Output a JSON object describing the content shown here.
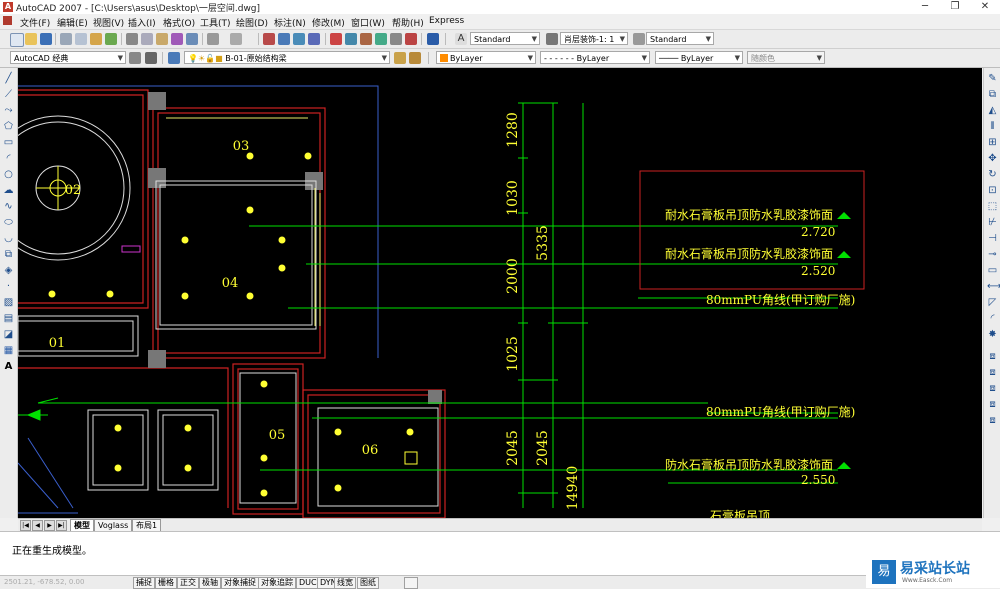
{
  "window": {
    "title": "AutoCAD 2007 - [C:\\Users\\asus\\Desktop\\一层空间.dwg]",
    "minimize": "─",
    "maximize": "❐",
    "close": "✕"
  },
  "menu": [
    "文件(F)",
    "编辑(E)",
    "视图(V)",
    "插入(I)",
    "格式(O)",
    "工具(T)",
    "绘图(D)",
    "标注(N)",
    "修改(M)",
    "窗口(W)",
    "帮助(H)",
    "Express"
  ],
  "toolbar1": {
    "text_style": "Standard",
    "dim_style": "肖层装饰-1: 1",
    "table_style": "Standard"
  },
  "toolbar2": {
    "workspace": "AutoCAD 经典",
    "layer": "B-01-原始结构梁",
    "color": "ByLayer",
    "linetype": "ByLayer",
    "lineweight": "ByLayer",
    "plotstyle": "随颜色",
    "linetype_dashes": "- - - - - -",
    "lineweight_line": "────"
  },
  "drawing": {
    "room_labels": [
      "01",
      "02",
      "03",
      "04",
      "05",
      "06"
    ],
    "dimensions": [
      "1280",
      "1030",
      "2000",
      "1025",
      "2045",
      "2045",
      "5335",
      "14940"
    ],
    "annotations": [
      {
        "text": "耐水石膏板吊顶防水乳胶漆饰面",
        "elev": "2.720"
      },
      {
        "text": "耐水石膏板吊顶防水乳胶漆饰面",
        "elev": "2.520"
      },
      {
        "text": "80mmPU角线(甲订购厂施)",
        "elev": ""
      },
      {
        "text": "80mmPU角线(甲订购厂施)",
        "elev": ""
      },
      {
        "text": "防水石膏板吊顶防水乳胶漆饰面",
        "elev": "2.550"
      },
      {
        "text": "石膏板吊顶",
        "elev": ""
      }
    ]
  },
  "layout_tabs": [
    "模型",
    "Voglass",
    "布局1"
  ],
  "tab_nav": [
    "|◀",
    "◀",
    "▶",
    "▶|"
  ],
  "command_line": "正在重生成模型。",
  "status": {
    "coords": "2501.21, -678.52, 0.00",
    "buttons": [
      "捕捉",
      "栅格",
      "正交",
      "极轴",
      "对象捕捉",
      "对象追踪",
      "DUCS",
      "DYN",
      "线宽",
      "图纸"
    ]
  },
  "watermark": {
    "logo": "易",
    "brand": "易采站长站",
    "url": "Www.Easck.Com"
  },
  "colors": {
    "canvas": "#000000",
    "green": "#00e000",
    "yellow": "#ffff33",
    "red": "#cc2222",
    "accent": "#1e73be"
  }
}
